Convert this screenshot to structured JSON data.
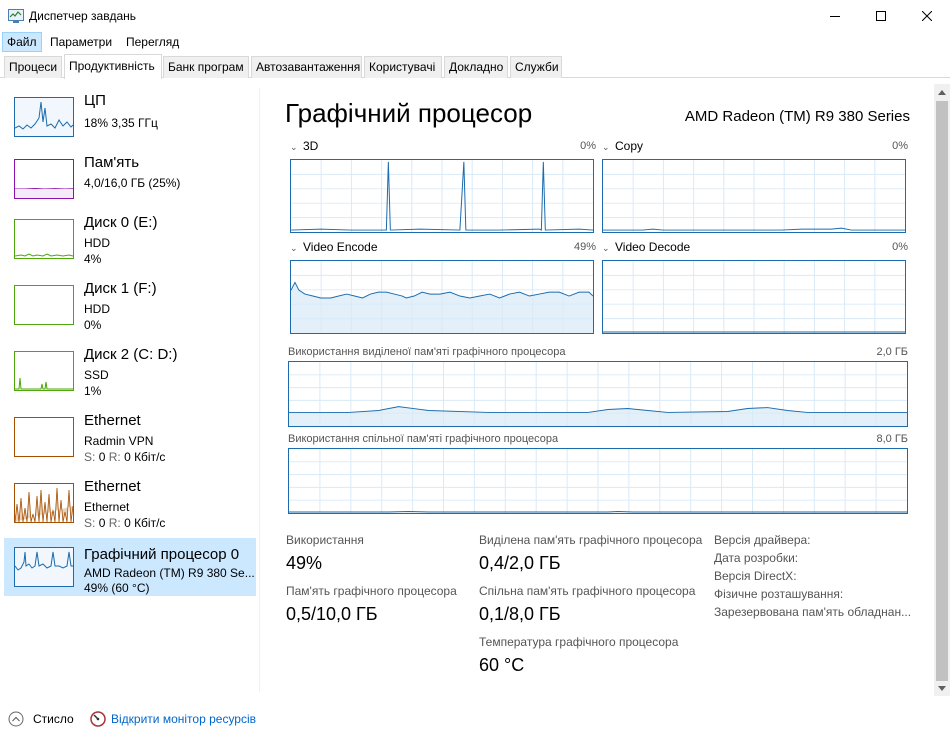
{
  "window": {
    "title": "Диспетчер завдань",
    "controls": {
      "minimize": "minimize-icon",
      "maximize": "maximize-icon",
      "close": "close-icon"
    }
  },
  "menu": {
    "items": [
      {
        "label": "Файл"
      },
      {
        "label": "Параметри"
      },
      {
        "label": "Перегляд"
      }
    ]
  },
  "tabs": [
    {
      "label": "Процеси"
    },
    {
      "label": "Продуктивність"
    },
    {
      "label": "Банк програм"
    },
    {
      "label": "Автозавантаження"
    },
    {
      "label": "Користувачі"
    },
    {
      "label": "Докладно"
    },
    {
      "label": "Служби"
    }
  ],
  "sidebar": {
    "items": [
      {
        "name": "ЦП",
        "line1": "18% 3,35 ГГц",
        "line2": "",
        "line3": "",
        "color": "#1b6bae"
      },
      {
        "name": "Пам'ять",
        "line1": "4,0/16,0 ГБ (25%)",
        "line2": "",
        "line3": "",
        "color": "#8b12ae"
      },
      {
        "name": "Диск 0 (E:)",
        "line1": "HDD",
        "line2": "4%",
        "line3": "",
        "color": "#4da60c"
      },
      {
        "name": "Диск 1 (F:)",
        "line1": "HDD",
        "line2": "0%",
        "line3": "",
        "color": "#4da60c"
      },
      {
        "name": "Диск 2 (C: D:)",
        "line1": "SSD",
        "line2": "1%",
        "line3": "",
        "color": "#4da60c"
      },
      {
        "name": "Ethernet",
        "line1": "Radmin VPN",
        "send_lbl": "S:",
        "send_val": "0",
        "recv_lbl": "R:",
        "recv_val": "0 Кбіт/с",
        "color": "#a74f01"
      },
      {
        "name": "Ethernet",
        "line1": "Ethernet",
        "send_lbl": "S:",
        "send_val": "0",
        "recv_lbl": "R:",
        "recv_val": "0 Кбіт/с",
        "color": "#a74f01"
      },
      {
        "name": "Графічний процесор 0",
        "line1": "AMD Radeon (TM) R9 380 Se...",
        "line2": "49% (60 °C)",
        "line3": "",
        "color": "#1b6bae"
      }
    ]
  },
  "main": {
    "title": "Графічний процесор",
    "device": "AMD Radeon (TM) R9 380 Series",
    "engines": [
      {
        "name": "3D",
        "pct": "0%"
      },
      {
        "name": "Copy",
        "pct": "0%"
      },
      {
        "name": "Video Encode",
        "pct": "49%"
      },
      {
        "name": "Video Decode",
        "pct": "0%"
      }
    ],
    "dedicated_mem": {
      "label": "Використання виділеної пам'яті графічного процесора",
      "max": "2,0 ГБ"
    },
    "shared_mem": {
      "label": "Використання спільної пам'яті графічного процесора",
      "max": "8,0 ГБ"
    },
    "stats": {
      "usage_lbl": "Використання",
      "usage_val": "49%",
      "gpu_mem_lbl": "Пам'ять графічного процесора",
      "gpu_mem_val": "0,5/10,0 ГБ",
      "ded_lbl": "Виділена пам'ять графічного процесора",
      "ded_val": "0,4/2,0 ГБ",
      "shared_lbl": "Спільна пам'ять графічного процесора",
      "shared_val": "0,1/8,0 ГБ",
      "temp_lbl": "Температура графічного процесора",
      "temp_val": "60 °C"
    },
    "info": [
      {
        "label": "Версія драйвера:"
      },
      {
        "label": "Дата розробки:"
      },
      {
        "label": "Версія DirectX:"
      },
      {
        "label": "Фізичне розташування:"
      },
      {
        "label": "Зарезервована пам'ять обладнан..."
      }
    ]
  },
  "footer": {
    "less": "Стисло",
    "monitor": "Відкрити монітор ресурсів"
  }
}
